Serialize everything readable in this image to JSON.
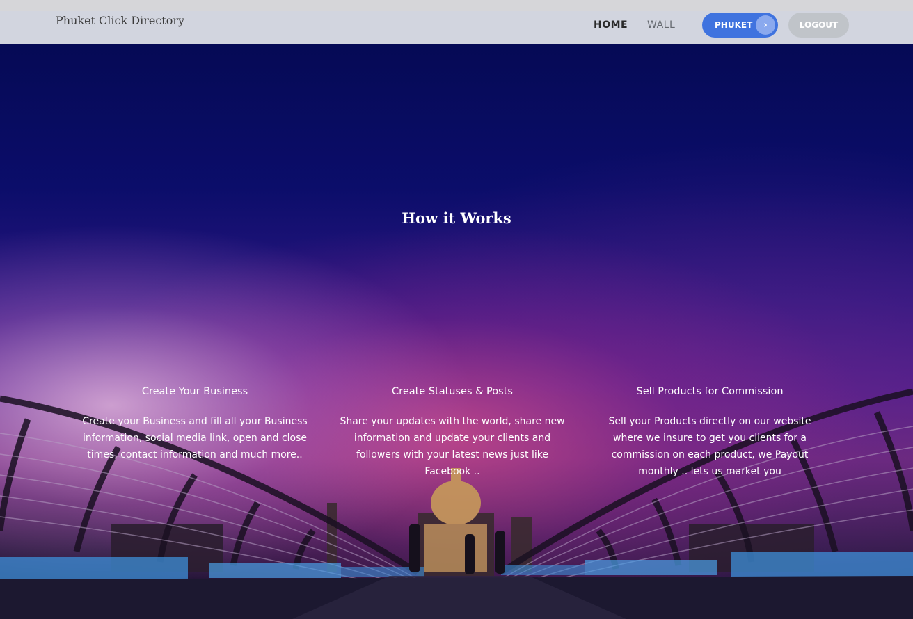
{
  "header": {
    "brand": "Phuket Click Directory",
    "nav": {
      "home": "HOME",
      "wall": "WALL"
    },
    "location_button": "PHUKET",
    "location_chevron": "›",
    "logout_button": "LOGOUT"
  },
  "hero": {
    "title": "How it Works",
    "features": [
      {
        "heading": "Create Your Business",
        "text": "Create your Business and fill all your Business information, social media link, open and close times, contact information and much more.."
      },
      {
        "heading": "Create Statuses & Posts",
        "text": "Share your updates with the world, share new information and update your clients and followers with your latest news just like Facebook .."
      },
      {
        "heading": "Sell Products for Commission",
        "text": "Sell your Products directly on our website where we insure to get you clients for a commission on each product, we Payout monthly .. lets us market you"
      }
    ]
  },
  "colors": {
    "primary": "#3f73df",
    "logout": "#c0c4c9",
    "navbar": "#d2d5df"
  },
  "icons": {
    "location_chevron": "chevron-right-icon"
  }
}
